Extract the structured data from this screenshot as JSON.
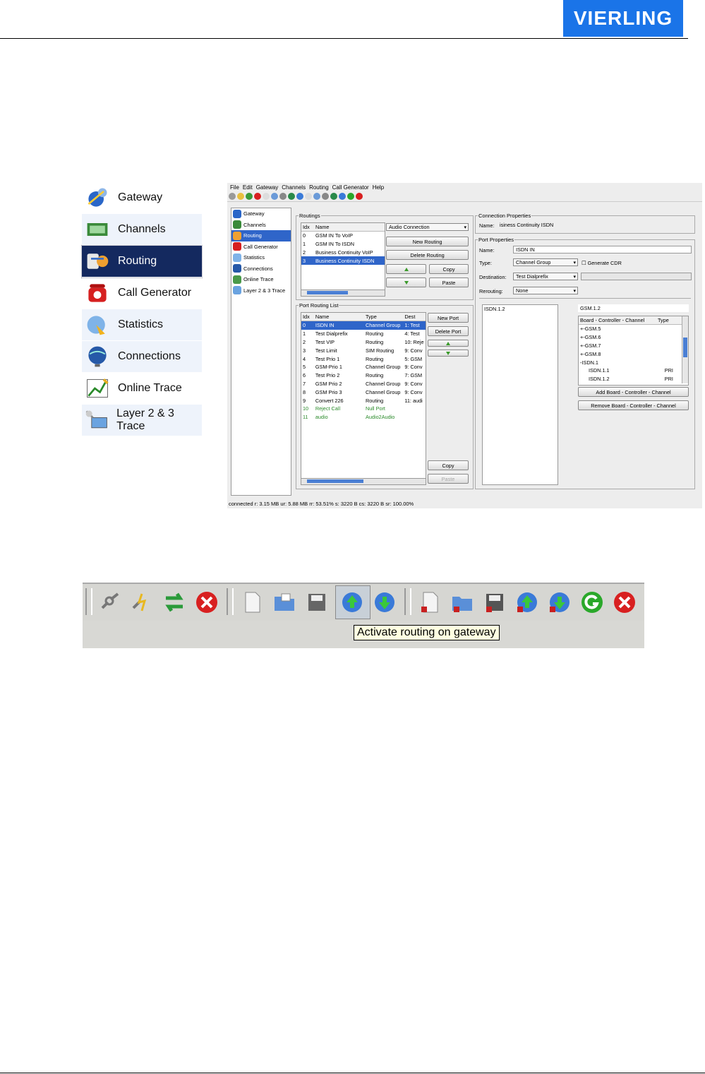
{
  "logo": "VIERLING",
  "big_nav": [
    "Gateway",
    "Channels",
    "Routing",
    "Call Generator",
    "Statistics",
    "Connections",
    "Online Trace",
    "Layer 2 & 3 Trace"
  ],
  "menu": [
    "File",
    "Edit",
    "Gateway",
    "Channels",
    "Routing",
    "Call Generator",
    "Help"
  ],
  "small_nav": [
    "Gateway",
    "Channels",
    "Routing",
    "Call Generator",
    "Statistics",
    "Connections",
    "Online Trace",
    "Layer 2 & 3 Trace"
  ],
  "routings": {
    "legend": "Routings",
    "headers": [
      "Idx",
      "Name"
    ],
    "rows": [
      [
        "0",
        "GSM IN To VoIP"
      ],
      [
        "1",
        "GSM IN To ISDN"
      ],
      [
        "2",
        "Business Continuity VoIP"
      ],
      [
        "3",
        "Business Continuity ISDN"
      ]
    ],
    "combo": "Audio Connection",
    "new_btn": "New Routing",
    "delete_btn": "Delete Routing",
    "copy_btn": "Copy",
    "paste_btn": "Paste"
  },
  "port_list": {
    "legend": "Port Routing List",
    "headers": [
      "Idx",
      "Name",
      "Type",
      "Dest"
    ],
    "rows": [
      [
        "0",
        "ISDN IN",
        "Channel Group",
        "1: Test"
      ],
      [
        "1",
        "Test Dialprefix",
        "Routing",
        "4: Test"
      ],
      [
        "2",
        "Test VIP",
        "Routing",
        "10: Reje"
      ],
      [
        "3",
        "Test Limit",
        "SIM Routing",
        "9: Conv"
      ],
      [
        "4",
        "Test Prio 1",
        "Routing",
        "5: GSM"
      ],
      [
        "5",
        "GSM-Prio 1",
        "Channel Group",
        "9: Conv"
      ],
      [
        "6",
        "Test Prio 2",
        "Routing",
        "7: GSM"
      ],
      [
        "7",
        "GSM Prio 2",
        "Channel Group",
        "9: Conv"
      ],
      [
        "8",
        "GSM Prio 3",
        "Channel Group",
        "9: Conv"
      ],
      [
        "9",
        "Convert 226",
        "Routing",
        "11: audi"
      ],
      [
        "10",
        "Reject Call",
        "Null Port",
        ""
      ],
      [
        "11",
        "audio",
        "Audio2Audio",
        ""
      ]
    ],
    "new_btn": "New Port",
    "delete_btn": "Delete Port",
    "copy_btn": "Copy",
    "paste_btn": "Paste"
  },
  "conn_props": {
    "legend": "Connection Properties",
    "name_label": "Name:",
    "name_value": "isiness Continuity ISDN"
  },
  "port_props": {
    "legend": "Port Properties",
    "name_label": "Name:",
    "name_value": "ISDN IN",
    "type_label": "Type:",
    "type_value": "Channel Group",
    "gen_cdr": "Generate CDR",
    "dest_label": "Destination:",
    "dest_value": "Test Dialprefix",
    "rerouting_label": "Rerouting:",
    "rerouting_value": "None",
    "left_list": [
      "ISDN.1.2"
    ],
    "right_field": "GSM.1.2",
    "tree_headers": [
      "Board - Controller - Channel",
      "Type"
    ],
    "tree": [
      [
        "+-GSM.5",
        ""
      ],
      [
        "+-GSM.6",
        ""
      ],
      [
        "+-GSM.7",
        ""
      ],
      [
        "+-GSM.8",
        ""
      ],
      [
        "-ISDN.1",
        ""
      ],
      [
        "ISDN.1.1",
        "PRI"
      ],
      [
        "ISDN.1.2",
        "PRI"
      ]
    ],
    "add_btn": "Add Board - Controller - Channel",
    "remove_btn": "Remove Board - Controller - Channel"
  },
  "status": "connected r: 3.15 MB ur: 5.88 MB rr: 53.51% s: 3220 B cs: 3220 B sr: 100.00%",
  "tooltip": "Activate routing on gateway"
}
